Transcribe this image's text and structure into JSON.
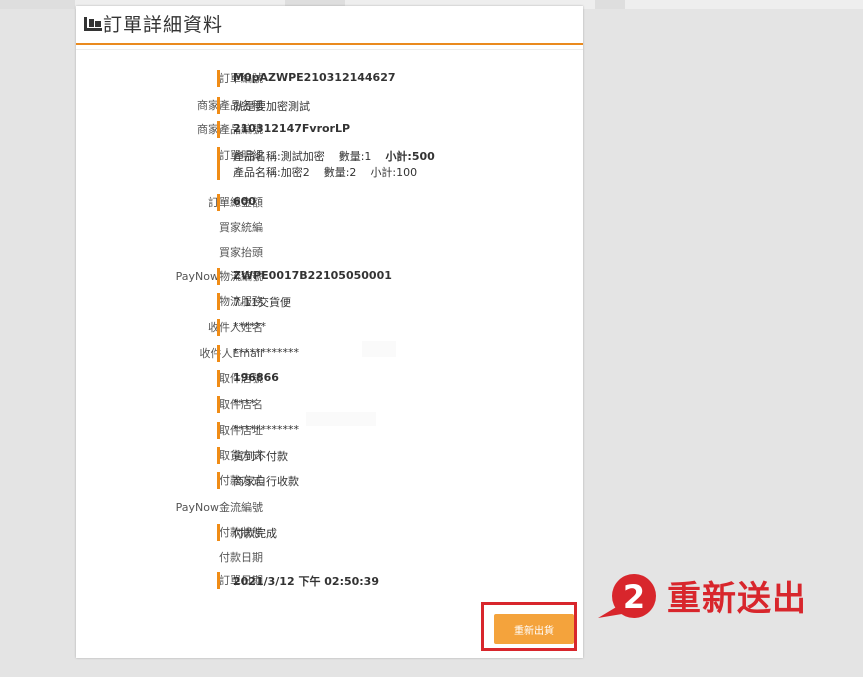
{
  "header": {
    "title": "訂單詳細資料"
  },
  "rows": [
    {
      "label": "訂單編號",
      "value": "M0pAZWPE210312144627",
      "bold": true
    },
    {
      "label": "商家產品名稱",
      "value": "就是要加密測試"
    },
    {
      "label": "商家產品編號",
      "value": "210312147FvrorLP",
      "bold": true
    },
    {
      "label": "訂單明細",
      "items": [
        {
          "name": "產品名稱:測試加密",
          "qty": "數量:1",
          "subtotal": "小計:500"
        },
        {
          "name": "產品名稱:加密2",
          "qty": "數量:2",
          "subtotal": "小計:100"
        }
      ]
    },
    {
      "label": "訂單總金額",
      "value": "600",
      "bold": true
    },
    {
      "label": "買家統編",
      "value": ""
    },
    {
      "label": "買家抬頭",
      "value": ""
    },
    {
      "label": "PayNow物流編號",
      "value": "ZWPE0017B22105050001",
      "bold": true
    },
    {
      "label": "物流服務",
      "value": "7-11交貨便"
    },
    {
      "label": "收件人姓名",
      "value": "******"
    },
    {
      "label": "收件人Email",
      "value": "************"
    },
    {
      "label": "取件店號",
      "value": "196866",
      "bold": true
    },
    {
      "label": "取件店名",
      "value": "****"
    },
    {
      "label": "取件店址",
      "value": "************"
    },
    {
      "label": "取貨方式",
      "value": "貨到不付款"
    },
    {
      "label": "付款方式",
      "value": "商家自行收款"
    },
    {
      "label": "PayNow金流編號",
      "value": ""
    },
    {
      "label": "付款狀態",
      "value": "付款完成"
    },
    {
      "label": "付款日期",
      "value": ""
    },
    {
      "label": "訂單日期",
      "value": "2021/3/12 下午 02:50:39",
      "bold": true
    }
  ],
  "actions": {
    "reship_button": "重新出貨"
  },
  "annotation": {
    "step_number": "2",
    "text": "重新送出"
  },
  "icons": {
    "title": "package-icon"
  },
  "colors": {
    "accent": "#f08c16",
    "button": "#f4a33c",
    "annotation_red": "#d8262c"
  }
}
